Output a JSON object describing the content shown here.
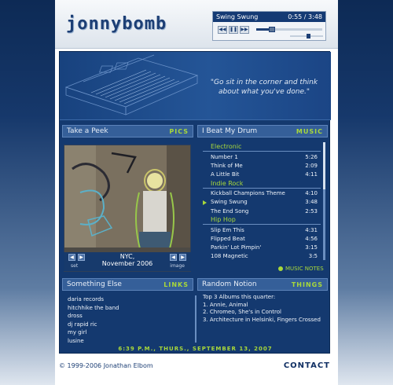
{
  "header": {
    "logo": "jonnybomb"
  },
  "player": {
    "track_title": "Swing Swung",
    "time": "0:55 / 3:48",
    "progress": 0.24,
    "volume": 0.55,
    "controls": [
      {
        "icon": "rewind-icon",
        "glyph": "◀◀"
      },
      {
        "icon": "pause-icon",
        "glyph": "❚❚"
      },
      {
        "icon": "fast-forward-icon",
        "glyph": "▶▶"
      }
    ]
  },
  "banner": {
    "quote": "\"Go sit in the corner and think about what you've done.\""
  },
  "peek": {
    "title": "Take a Peek",
    "tag": "PICS",
    "caption_line1": "NYC,",
    "caption_line2": "November 2006",
    "set_label": "set",
    "image_label": "image"
  },
  "music": {
    "title": "I Beat My Drum",
    "tag": "MUSIC",
    "genres": [
      {
        "name": "Electronic",
        "songs": [
          {
            "title": "Number 1",
            "time": "5:26"
          },
          {
            "title": "Think of Me",
            "time": "2:09"
          },
          {
            "title": "A Little Bit",
            "time": "4:11"
          }
        ]
      },
      {
        "name": "Indie Rock",
        "songs": [
          {
            "title": "Kickball Champions Theme",
            "time": "4:10"
          },
          {
            "title": "Swing Swung",
            "time": "3:48",
            "playing": true
          },
          {
            "title": "The End Song",
            "time": "2:53"
          }
        ]
      },
      {
        "name": "Hip Hop",
        "songs": [
          {
            "title": "Slip Em This",
            "time": "4:31"
          },
          {
            "title": "Flipped Beat",
            "time": "4:56"
          },
          {
            "title": "Parkin' Lot Pimpin'",
            "time": "3:15"
          },
          {
            "title": "108 Magnetic",
            "time": "3:5"
          }
        ]
      }
    ],
    "notes_label": "MUSIC NOTES"
  },
  "links": {
    "title": "Something Else",
    "tag": "LINKS",
    "items": [
      "daria records",
      "hitchhike the band",
      "dross",
      "dj rapid ric",
      "my girl",
      "lusine"
    ]
  },
  "random": {
    "title": "Random Notion",
    "tag": "THINGS",
    "lines": [
      "Top 3 Albums this quarter:",
      "1. Annie, Animal",
      "2. Chromeo, She's in Control",
      "3. Architecture in Helsinki, Fingers Crossed"
    ]
  },
  "timestamp": "6:39 P.M., THURS., SEPTEMBER 13, 2007",
  "footer": {
    "copyright": "© 1999-2006 Jonathan Elbom",
    "contact": "CONTACT"
  },
  "colors": {
    "navy": "#14396f",
    "accent_green": "#a8d83a",
    "header_blue": "#355f99"
  }
}
